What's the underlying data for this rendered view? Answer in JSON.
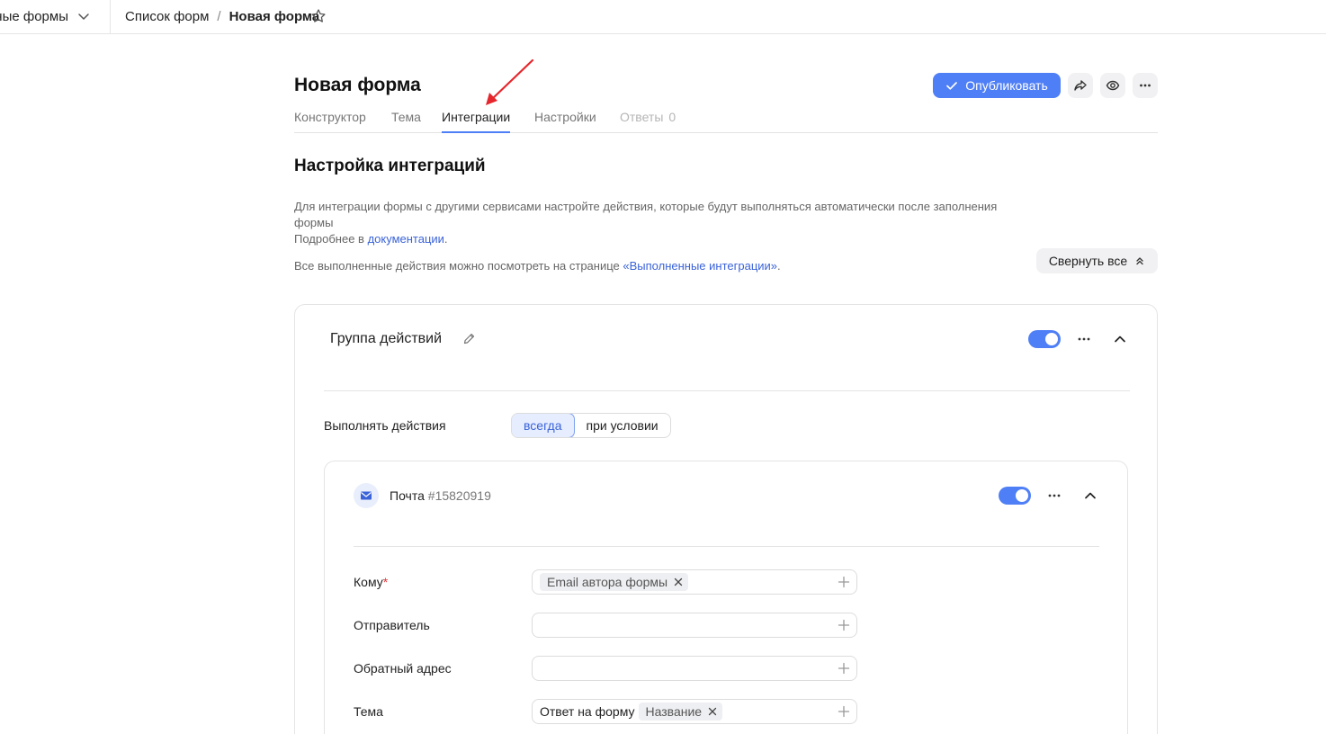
{
  "topbar": {
    "workspace_label": "ные формы",
    "breadcrumb": [
      "Список форм",
      "Новая форма"
    ],
    "separator": "/"
  },
  "header": {
    "title": "Новая форма",
    "publish_label": "Опубликовать"
  },
  "tabs": [
    {
      "label": "Конструктор",
      "state": "normal"
    },
    {
      "label": "Тема",
      "state": "normal"
    },
    {
      "label": "Интеграции",
      "state": "active"
    },
    {
      "label": "Настройки",
      "state": "normal"
    },
    {
      "label": "Ответы",
      "count": "0",
      "state": "disabled"
    }
  ],
  "integrations": {
    "title": "Настройка интеграций",
    "description": "Для интеграции формы с другими сервисами настройте действия, которые будут выполняться автоматически после заполнения формы",
    "docs_prefix": "Подробнее в ",
    "docs_link": "документации",
    "docs_suffix": ".",
    "executed_prefix": "Все выполненные действия можно посмотреть на странице ",
    "executed_link": "«Выполненные интеграции»",
    "executed_suffix": ".",
    "collapse_all_label": "Свернуть все"
  },
  "group": {
    "title": "Группа действий",
    "enabled": true,
    "execute_label": "Выполнять действия",
    "execute_options": [
      "всегда",
      "при условии"
    ],
    "execute_selected": "всегда"
  },
  "mail_action": {
    "title": "Почта",
    "id": "#15820919",
    "enabled": true,
    "fields": [
      {
        "label": "Кому",
        "required": "*",
        "prefix": "",
        "chip": "Email автора формы"
      },
      {
        "label": "Отправитель",
        "required": "",
        "prefix": "",
        "chip": ""
      },
      {
        "label": "Обратный адрес",
        "required": "",
        "prefix": "",
        "chip": ""
      },
      {
        "label": "Тема",
        "required": "",
        "prefix": "Ответ на форму",
        "chip": "Название"
      }
    ]
  },
  "colors": {
    "accent": "#4f7ff6",
    "link": "#3a63d8",
    "annotation_arrow": "#e5262c"
  }
}
